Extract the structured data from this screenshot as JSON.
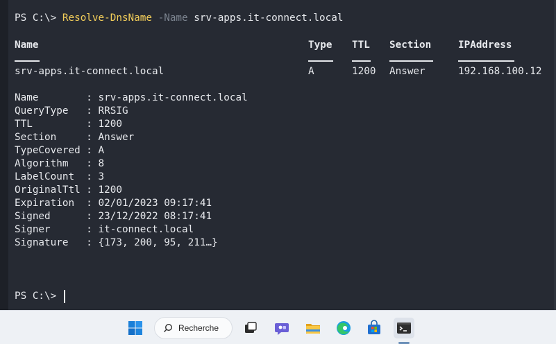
{
  "command": {
    "prompt": "PS C:\\> ",
    "cmdlet": "Resolve-DnsName",
    "param": " -Name",
    "arg": " srv-apps.it-connect.local"
  },
  "table": {
    "headers": [
      "Name",
      "Type",
      "TTL",
      "Section",
      "IPAddress"
    ],
    "row": [
      "srv-apps.it-connect.local",
      "A",
      "1200",
      "Answer",
      "192.168.100.12"
    ]
  },
  "record": [
    {
      "label": "Name        ",
      "value": ": srv-apps.it-connect.local"
    },
    {
      "label": "QueryType   ",
      "value": ": RRSIG"
    },
    {
      "label": "TTL         ",
      "value": ": 1200"
    },
    {
      "label": "Section     ",
      "value": ": Answer"
    },
    {
      "label": "TypeCovered ",
      "value": ": A"
    },
    {
      "label": "Algorithm   ",
      "value": ": 8"
    },
    {
      "label": "LabelCount  ",
      "value": ": 3"
    },
    {
      "label": "OriginalTtl ",
      "value": ": 1200"
    },
    {
      "label": "Expiration  ",
      "value": ": 02/01/2023 09:17:41"
    },
    {
      "label": "Signed      ",
      "value": ": 23/12/2022 08:17:41"
    },
    {
      "label": "Signer      ",
      "value": ": it-connect.local"
    },
    {
      "label": "Signature   ",
      "value": ": {173, 200, 95, 211…}"
    }
  ],
  "final_prompt": "PS C:\\> ",
  "taskbar": {
    "search_label": "Recherche",
    "items": [
      "windows-start",
      "search",
      "task-view",
      "chat",
      "file-explorer",
      "edge",
      "store",
      "terminal"
    ]
  },
  "colors": {
    "terminal_bg": "#262a33",
    "cmdlet": "#f3ce5a",
    "param": "#7d8591",
    "text": "#e6e8ec",
    "taskbar_bg": "#eef1f5"
  }
}
